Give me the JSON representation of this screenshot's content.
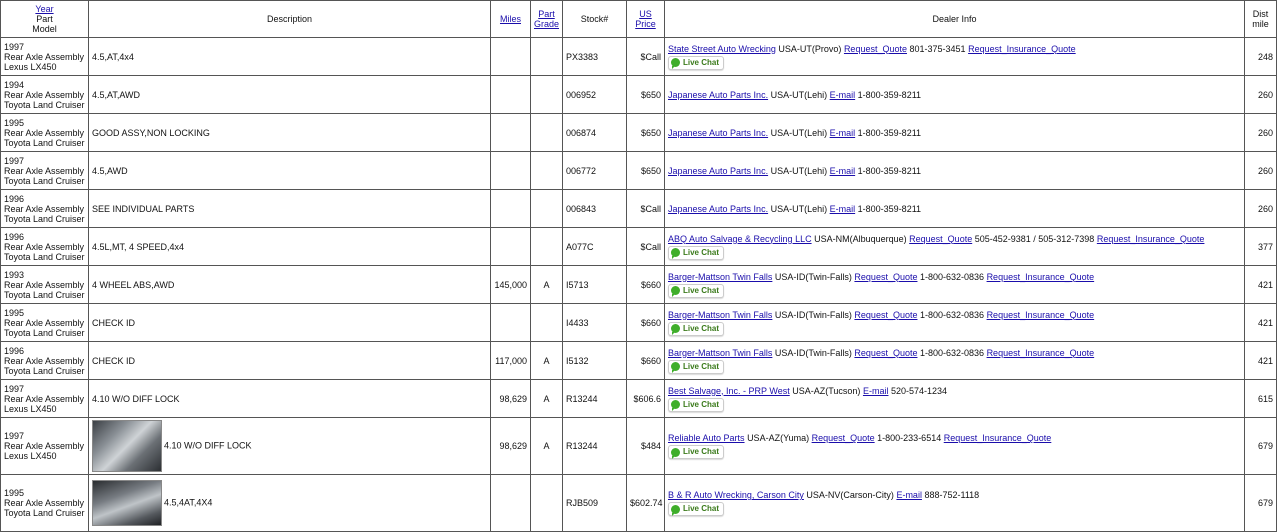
{
  "headers": {
    "year": "Year",
    "part": "Part",
    "model": "Model",
    "description": "Description",
    "miles": "Miles",
    "part_grade_1": "Part",
    "part_grade_2": "Grade",
    "stock": "Stock#",
    "us_price_1": "US",
    "us_price_2": "Price",
    "dealer_info": "Dealer Info",
    "dist_1": "Dist",
    "dist_2": "mile"
  },
  "live_chat_label": "Live Chat",
  "rows": [
    {
      "year": "1997",
      "part": "Rear Axle Assembly",
      "model": "Lexus LX450",
      "desc": "4.5,AT,4x4",
      "miles": "",
      "grade": "",
      "stock": "PX3383",
      "price": "$Call",
      "dealer": "State Street Auto Wrecking",
      "loc": "USA-UT(Provo)",
      "l1": "Request_Quote",
      "phone": "801-375-3451",
      "l2": "Request_Insurance_Quote",
      "dist": "248"
    },
    {
      "year": "1994",
      "part": "Rear Axle Assembly",
      "model": "Toyota Land Cruiser",
      "desc": "4.5,AT,AWD",
      "miles": "",
      "grade": "",
      "stock": "006952",
      "price": "$650",
      "dealer": "Japanese Auto Parts Inc.",
      "loc": "USA-UT(Lehi)",
      "l1": "E-mail",
      "phone": "1-800-359-8211",
      "l2": "",
      "dist": "260"
    },
    {
      "year": "1995",
      "part": "Rear Axle Assembly",
      "model": "Toyota Land Cruiser",
      "desc": "GOOD ASSY,NON LOCKING",
      "miles": "",
      "grade": "",
      "stock": "006874",
      "price": "$650",
      "dealer": "Japanese Auto Parts Inc.",
      "loc": "USA-UT(Lehi)",
      "l1": "E-mail",
      "phone": "1-800-359-8211",
      "l2": "",
      "dist": "260"
    },
    {
      "year": "1997",
      "part": "Rear Axle Assembly",
      "model": "Toyota Land Cruiser",
      "desc": "4.5,AWD",
      "miles": "",
      "grade": "",
      "stock": "006772",
      "price": "$650",
      "dealer": "Japanese Auto Parts Inc.",
      "loc": "USA-UT(Lehi)",
      "l1": "E-mail",
      "phone": "1-800-359-8211",
      "l2": "",
      "dist": "260"
    },
    {
      "year": "1996",
      "part": "Rear Axle Assembly",
      "model": "Toyota Land Cruiser",
      "desc": "SEE INDIVIDUAL PARTS",
      "miles": "",
      "grade": "",
      "stock": "006843",
      "price": "$Call",
      "dealer": "Japanese Auto Parts Inc.",
      "loc": "USA-UT(Lehi)",
      "l1": "E-mail",
      "phone": "1-800-359-8211",
      "l2": "",
      "dist": "260"
    },
    {
      "year": "1996",
      "part": "Rear Axle Assembly",
      "model": "Toyota Land Cruiser",
      "desc": "4.5L,MT, 4 SPEED,4x4",
      "miles": "",
      "grade": "",
      "stock": "A077C",
      "price": "$Call",
      "dealer": "ABQ Auto Salvage & Recycling LLC",
      "loc": "USA-NM(Albuquerque)",
      "l1": "Request_Quote",
      "phone": "505-452-9381 / 505-312-7398",
      "l2": "Request_Insurance_Quote",
      "dist": "377"
    },
    {
      "year": "1993",
      "part": "Rear Axle Assembly",
      "model": "Toyota Land Cruiser",
      "desc": "4 WHEEL ABS,AWD",
      "miles": "145,000",
      "grade": "A",
      "stock": "I5713",
      "price": "$660",
      "dealer": "Barger-Mattson Twin Falls",
      "loc": "USA-ID(Twin-Falls)",
      "l1": "Request_Quote",
      "phone": "1-800-632-0836",
      "l2": "Request_Insurance_Quote",
      "dist": "421"
    },
    {
      "year": "1995",
      "part": "Rear Axle Assembly",
      "model": "Toyota Land Cruiser",
      "desc": "CHECK ID",
      "miles": "",
      "grade": "",
      "stock": "I4433",
      "price": "$660",
      "dealer": "Barger-Mattson Twin Falls",
      "loc": "USA-ID(Twin-Falls)",
      "l1": "Request_Quote",
      "phone": "1-800-632-0836",
      "l2": "Request_Insurance_Quote",
      "dist": "421"
    },
    {
      "year": "1996",
      "part": "Rear Axle Assembly",
      "model": "Toyota Land Cruiser",
      "desc": "CHECK ID",
      "miles": "117,000",
      "grade": "A",
      "stock": "I5132",
      "price": "$660",
      "dealer": "Barger-Mattson Twin Falls",
      "loc": "USA-ID(Twin-Falls)",
      "l1": "Request_Quote",
      "phone": "1-800-632-0836",
      "l2": "Request_Insurance_Quote",
      "dist": "421"
    },
    {
      "year": "1997",
      "part": "Rear Axle Assembly",
      "model": "Lexus LX450",
      "desc": "4.10 W/O DIFF LOCK",
      "miles": "98,629",
      "grade": "A",
      "stock": "R13244",
      "price": "$606.6",
      "dealer": "Best Salvage, Inc. - PRP West",
      "loc": "USA-AZ(Tucson)",
      "l1": "E-mail",
      "phone": "520-574-1234",
      "l2": "",
      "dist": "615"
    },
    {
      "year": "1997",
      "part": "Rear Axle Assembly",
      "model": "Lexus LX450",
      "desc": "4.10 W/O DIFF LOCK",
      "miles": "98,629",
      "grade": "A",
      "stock": "R13244",
      "price": "$484",
      "dealer": "Reliable Auto Parts",
      "loc": "USA-AZ(Yuma)",
      "l1": "Request_Quote",
      "phone": "1-800-233-6514",
      "l2": "Request_Insurance_Quote",
      "dist": "679"
    },
    {
      "year": "1995",
      "part": "Rear Axle Assembly",
      "model": "Toyota Land Cruiser",
      "desc": "4.5,4AT,4X4",
      "miles": "",
      "grade": "",
      "stock": "RJB509",
      "price": "$602.74",
      "dealer": "B & R Auto Wrecking, Carson City",
      "loc": "USA-NV(Carson-City)",
      "l1": "E-mail",
      "phone": "888-752-1118",
      "l2": "",
      "dist": "679"
    }
  ]
}
